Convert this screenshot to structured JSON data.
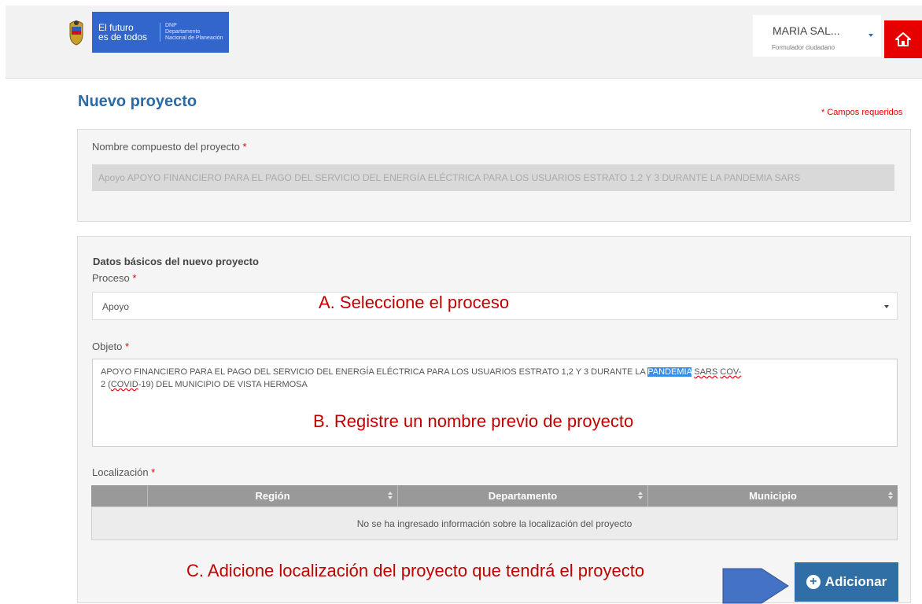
{
  "header": {
    "logo_line1": "El futuro",
    "logo_line2": "es de todos",
    "logo_org1": "DNP",
    "logo_org2": "Departamento",
    "logo_org3": "Nacional de Planeación",
    "user_name": "MARIA SAL...",
    "user_role": "Formulador ciudadano",
    "home_icon": "home-icon"
  },
  "page": {
    "title": "Nuevo proyecto",
    "required_note": "* Campos requeridos"
  },
  "nombre": {
    "label": "Nombre compuesto del proyecto",
    "required_mark": "*",
    "value": "Apoyo APOYO FINANCIERO PARA EL PAGO DEL SERVICIO DEL ENERGÍA ELÉCTRICA PARA LOS USUARIOS ESTRATO 1,2 Y 3 DURANTE LA PANDEMIA SARS"
  },
  "datos": {
    "section_title": "Datos básicos del nuevo proyecto",
    "proceso_label": "Proceso",
    "proceso_required": "*",
    "proceso_value": "Apoyo",
    "annot_a": "A. Seleccione el proceso",
    "objeto_label": "Objeto",
    "objeto_required": "*",
    "objeto_text_1": "APOYO FINANCIERO PARA EL PAGO DEL SERVICIO DEL ENERGÍA ELÉCTRICA PARA LOS USUARIOS ESTRATO 1,2 Y 3 DURANTE LA ",
    "objeto_highlight": "PANDEMIA",
    "objeto_text_2": " ",
    "objeto_sars": "SARS",
    "objeto_text_3": " ",
    "objeto_cov": "COV-",
    "objeto_text_4": "2 (",
    "objeto_covid": "COVID",
    "objeto_text_5": "-19) DEL MUNICIPIO DE VISTA HERMOSA",
    "annot_b": "B. Registre un nombre previo de proyecto",
    "localizacion_label": "Localización",
    "localizacion_required": "*"
  },
  "table": {
    "columns": [
      "",
      "Región",
      "Departamento",
      "Municipio"
    ],
    "empty_message": "No se ha ingresado información sobre la localización del proyecto"
  },
  "footer": {
    "annot_c": "C. Adicione localización del proyecto que tendrá el proyecto",
    "add_label": "Adicionar",
    "add_icon": "plus-circle-icon"
  },
  "colors": {
    "title_blue": "#2c6aa6",
    "required_red": "#e60000",
    "annotation_red": "#c00000",
    "button_blue": "#2f6fa6",
    "arrow_blue": "#4472c4"
  }
}
